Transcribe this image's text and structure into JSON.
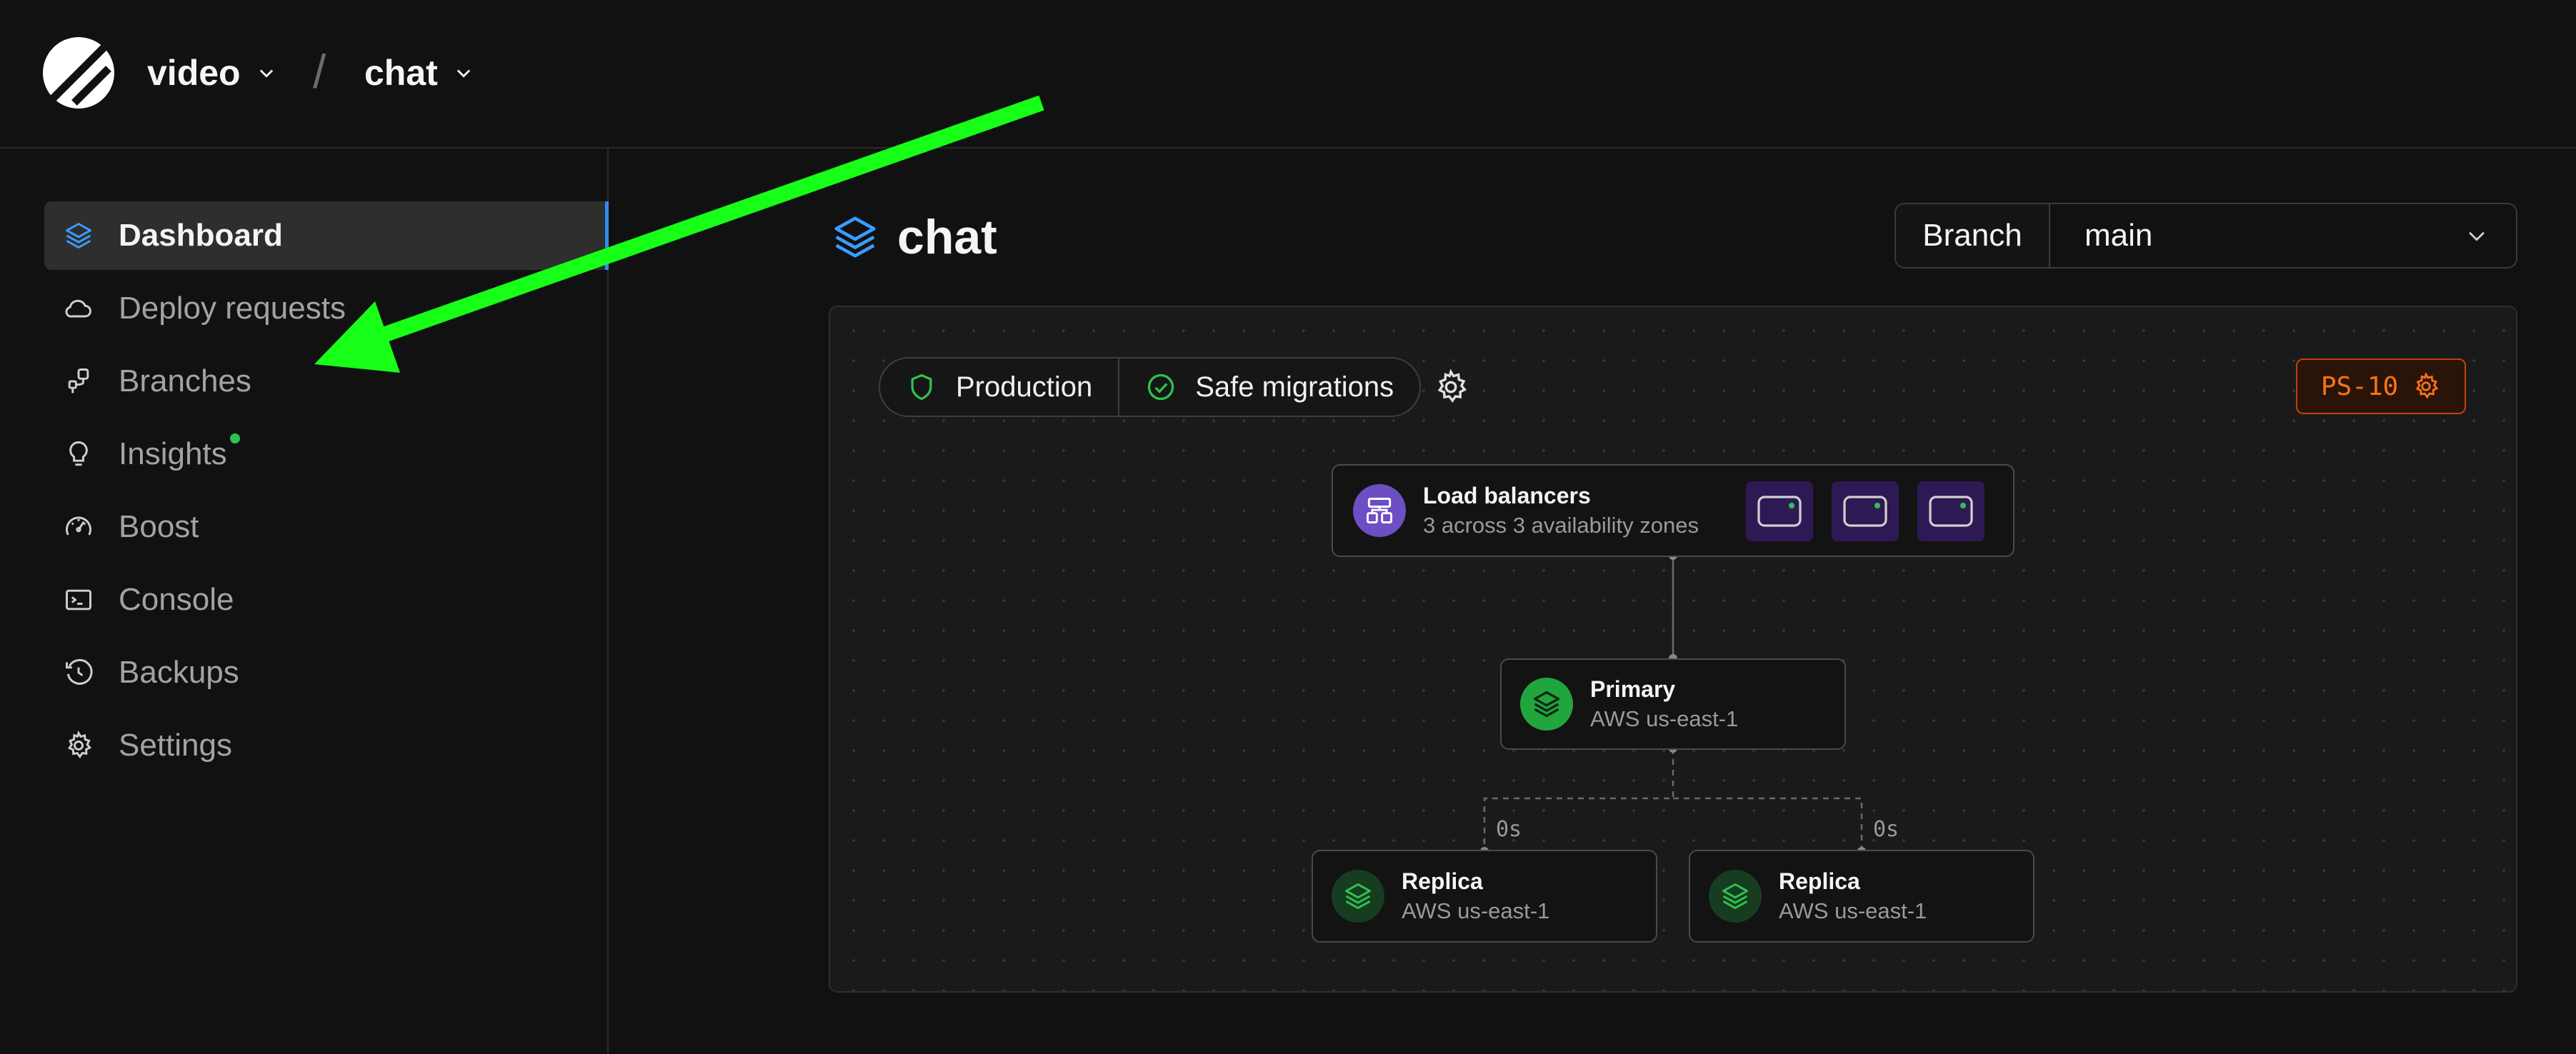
{
  "breadcrumb": {
    "org": "video",
    "separator": "/",
    "database": "chat"
  },
  "sidebar": {
    "items": [
      {
        "label": "Dashboard",
        "icon": "layers-icon",
        "active": true
      },
      {
        "label": "Deploy requests",
        "icon": "cloud-icon"
      },
      {
        "label": "Branches",
        "icon": "branch-icon"
      },
      {
        "label": "Insights",
        "icon": "lightbulb-icon",
        "badge": "new-dot"
      },
      {
        "label": "Boost",
        "icon": "gauge-icon"
      },
      {
        "label": "Console",
        "icon": "terminal-icon"
      },
      {
        "label": "Backups",
        "icon": "clock-icon"
      },
      {
        "label": "Settings",
        "icon": "gear-icon"
      }
    ]
  },
  "page": {
    "title": "chat",
    "title_icon": "layers-icon"
  },
  "branch_selector": {
    "label": "Branch",
    "value": "main"
  },
  "environment": {
    "production_label": "Production",
    "safe_migrations_label": "Safe migrations",
    "badge": "PS-10"
  },
  "topology": {
    "load_balancers": {
      "title": "Load balancers",
      "subtitle": "3 across 3 availability zones",
      "count": 3
    },
    "primary": {
      "title": "Primary",
      "subtitle": "AWS us-east-1"
    },
    "replicas": [
      {
        "title": "Replica",
        "subtitle": "AWS us-east-1",
        "lag": "0s"
      },
      {
        "title": "Replica",
        "subtitle": "AWS us-east-1",
        "lag": "0s"
      }
    ]
  },
  "colors": {
    "background": "#111111",
    "accent_blue": "#2f8cf0",
    "status_green": "#2fc24f",
    "badge_orange": "#f97316",
    "load_balancer_purple": "#6d4fc4",
    "annotation_arrow": "#17ff17"
  }
}
